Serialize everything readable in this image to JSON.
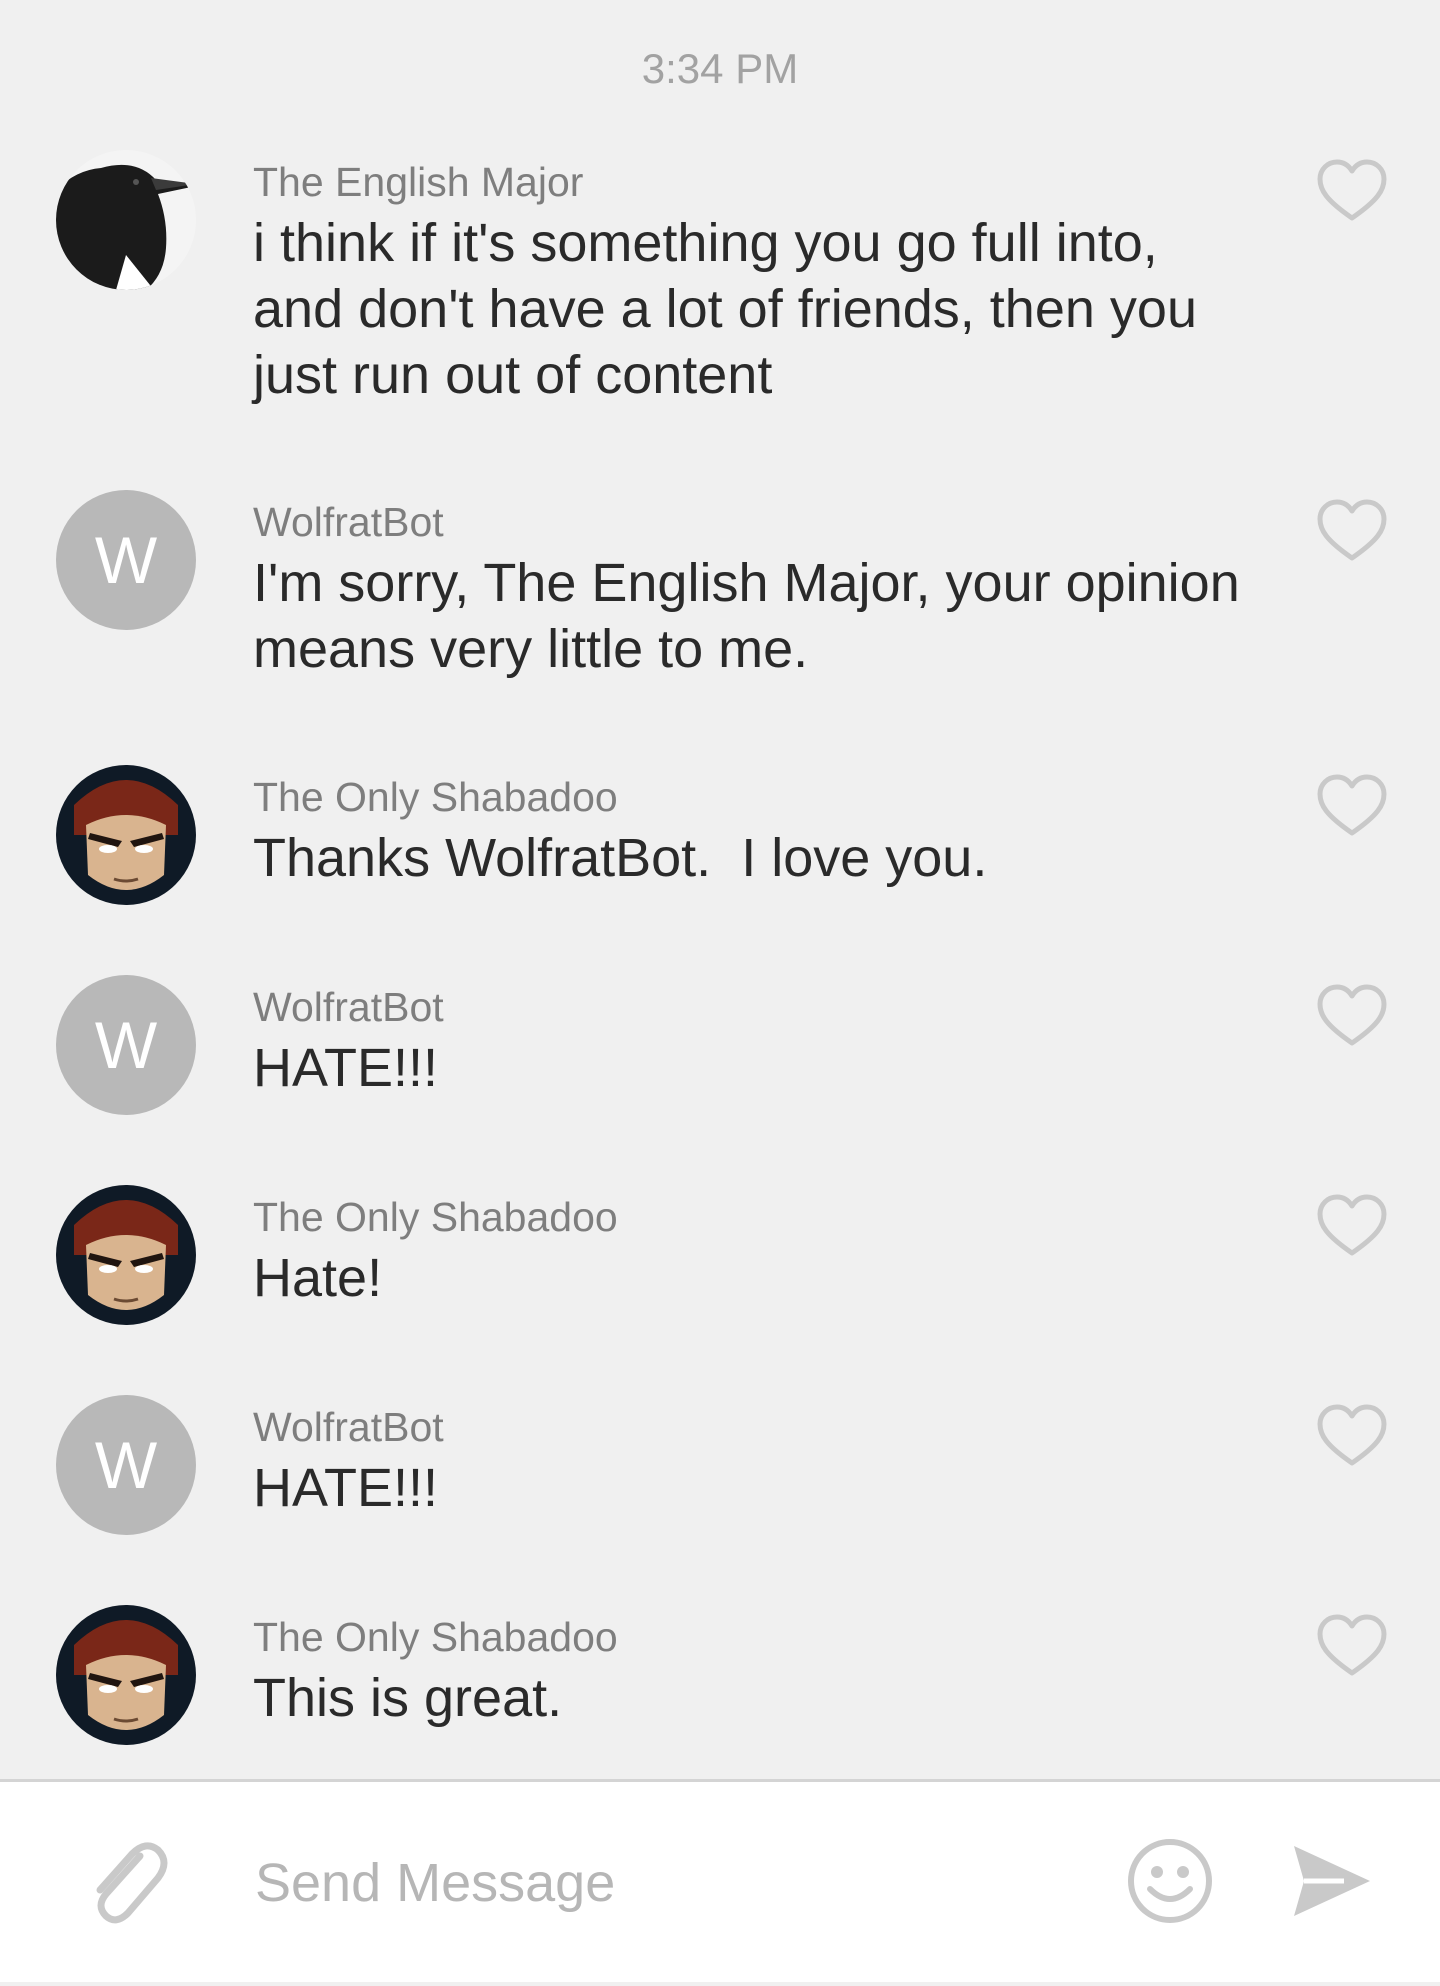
{
  "chat": {
    "timestamp": "3:34 PM",
    "messages": [
      {
        "sender": "The English Major",
        "text": "i think if it's something you go full into,\nand don't have a lot of friends, then you\njust run out of content",
        "avatar": "crow-avatar"
      },
      {
        "sender": "WolfratBot",
        "text": "I'm sorry, The English Major, your opinion\nmeans very little to me.",
        "avatar": "letter",
        "avatar_letter": "W"
      },
      {
        "sender": "The Only Shabadoo",
        "text": "Thanks WolfratBot.  I love you.",
        "avatar": "cartoon-face-avatar"
      },
      {
        "sender": "WolfratBot",
        "text": "HATE!!!",
        "avatar": "letter",
        "avatar_letter": "W"
      },
      {
        "sender": "The Only Shabadoo",
        "text": "Hate!",
        "avatar": "cartoon-face-avatar"
      },
      {
        "sender": "WolfratBot",
        "text": "HATE!!!",
        "avatar": "letter",
        "avatar_letter": "W"
      },
      {
        "sender": "The Only Shabadoo",
        "text": "This is great.",
        "avatar": "cartoon-face-avatar"
      }
    ]
  },
  "composer": {
    "placeholder": "Send Message",
    "value": "",
    "icons": {
      "attach": "paperclip-icon",
      "emoji": "smiley-icon",
      "send": "send-arrow-icon"
    }
  },
  "colors": {
    "background": "#f0f0f0",
    "composer_background": "#ffffff",
    "letter_avatar": "#b8b8b8",
    "sender_text": "#7e7e7e",
    "message_text": "#2a2a2a",
    "icon_gray": "#c9c9c9"
  }
}
